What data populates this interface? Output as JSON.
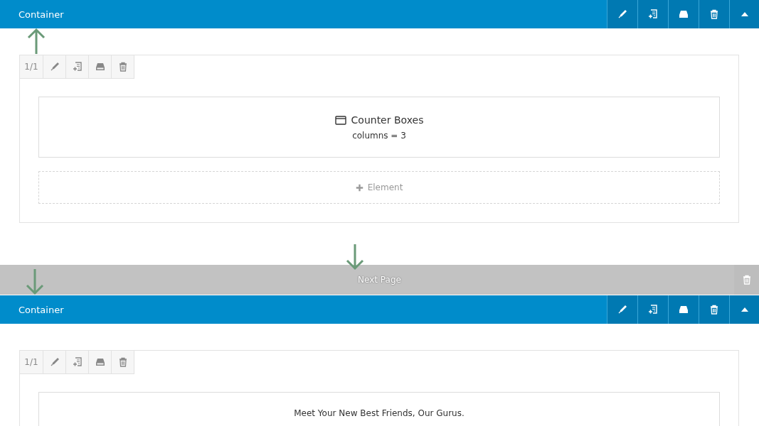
{
  "sections": [
    {
      "kind": "container",
      "title": "Container",
      "columns": [
        {
          "width": "1/1",
          "elements": [
            {
              "kind": "element",
              "title": "Counter Boxes",
              "detail": "columns = 3"
            },
            {
              "kind": "add",
              "label": "Element"
            }
          ]
        }
      ]
    },
    {
      "kind": "pagebreak",
      "label": "Next Page"
    },
    {
      "kind": "container",
      "title": "Container",
      "columns": [
        {
          "width": "1/1",
          "elements": [
            {
              "kind": "text",
              "title": "Meet Your New Best Friends, Our Gurus."
            }
          ]
        }
      ]
    }
  ],
  "annotations": [
    {
      "kind": "arrow-up"
    },
    {
      "kind": "arrow-down"
    },
    {
      "kind": "arrow-down"
    }
  ]
}
